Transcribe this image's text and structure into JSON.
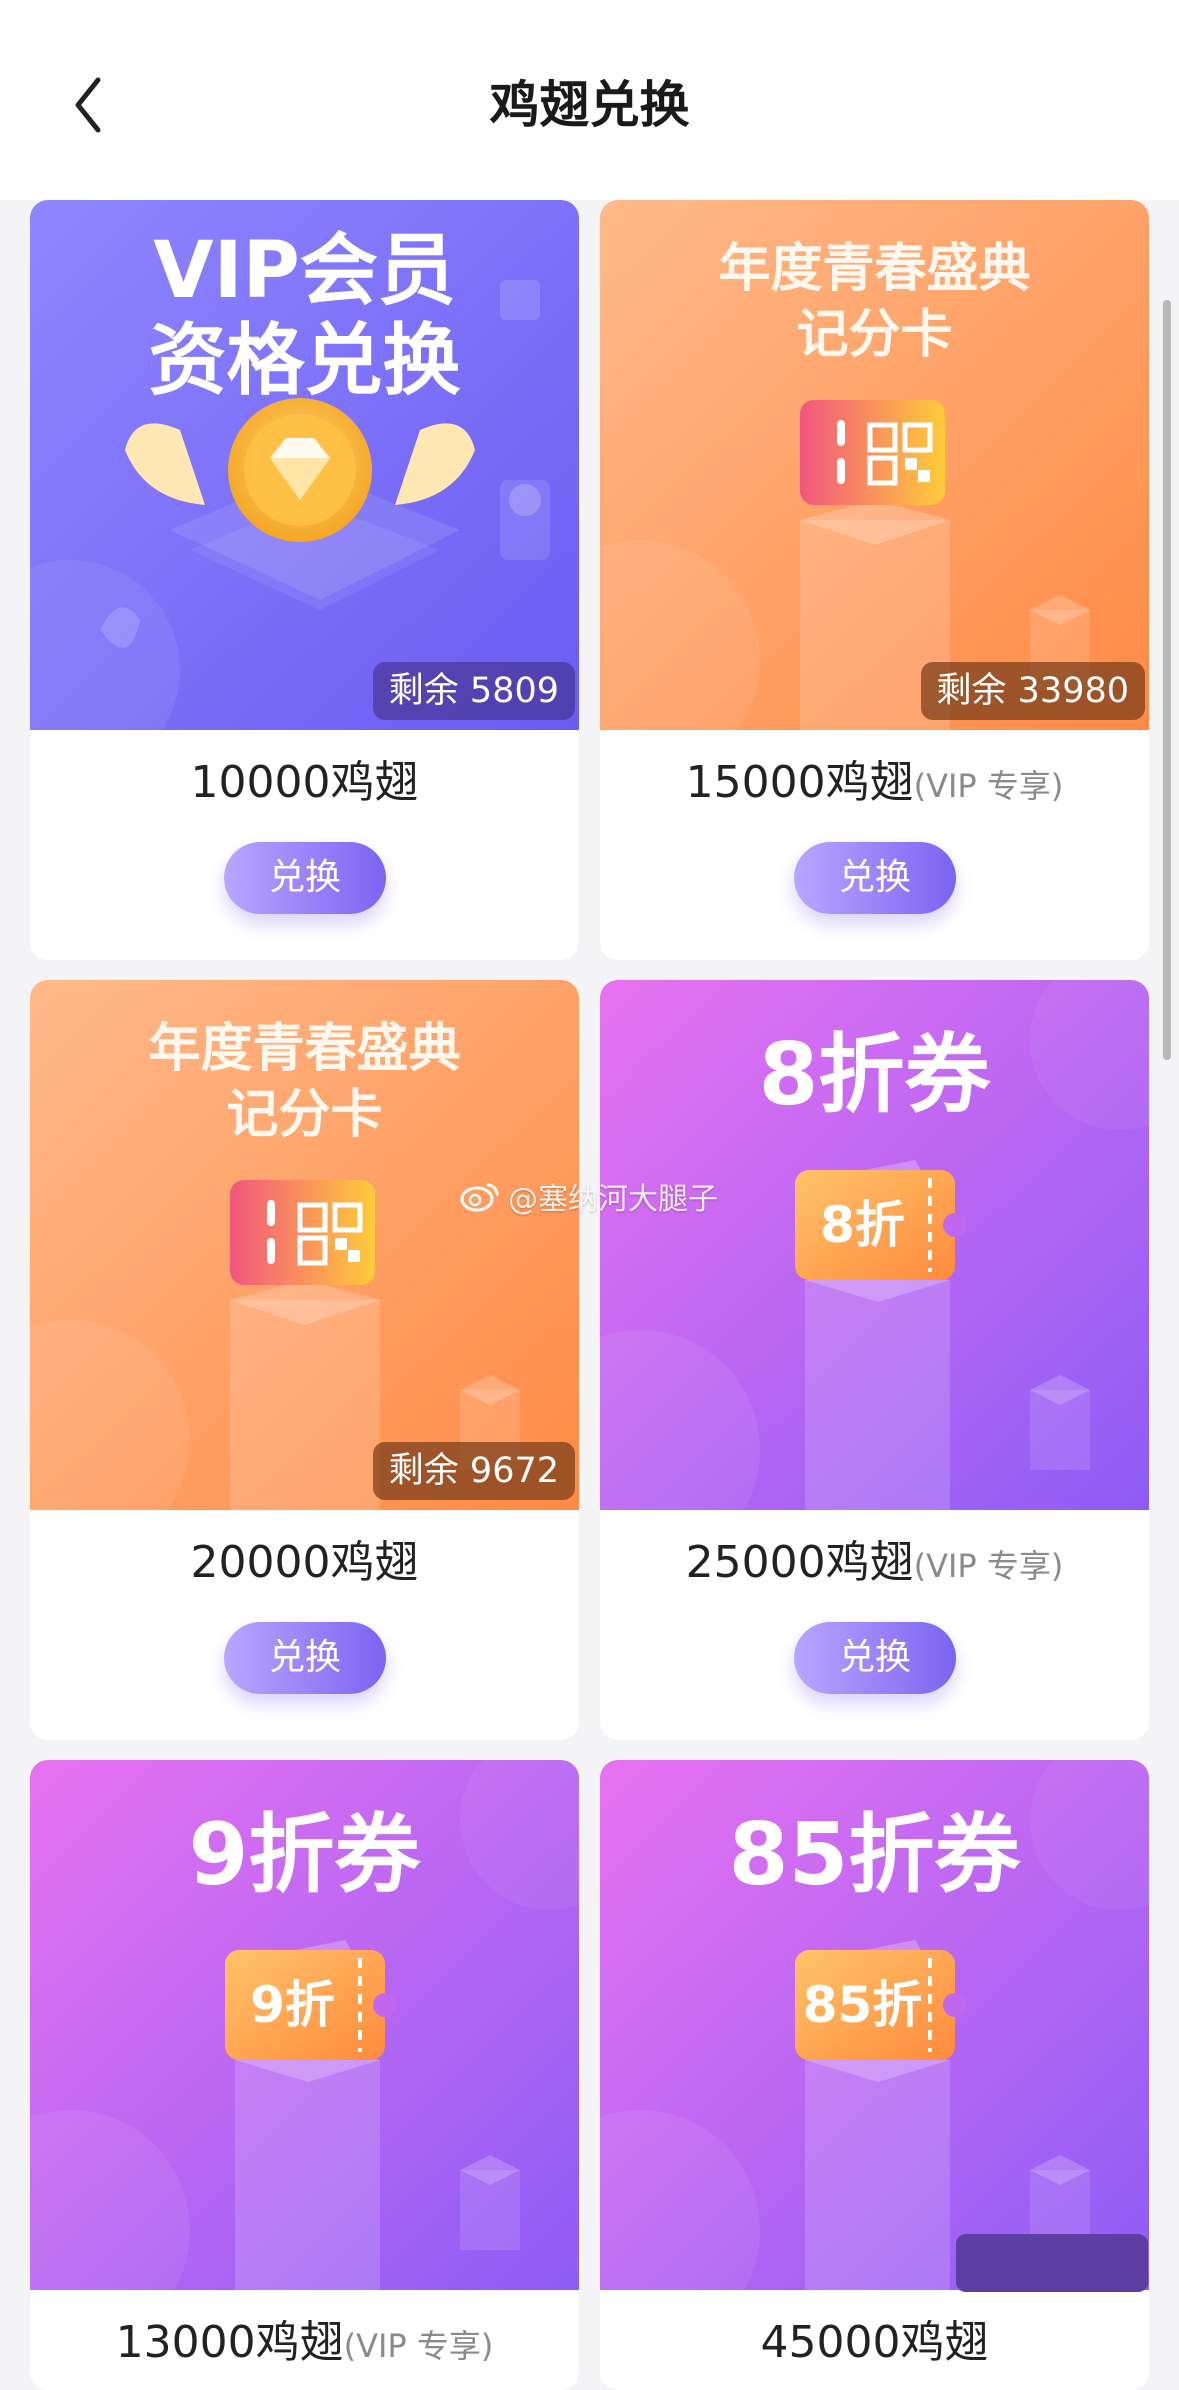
{
  "header": {
    "title": "鸡翅兑换"
  },
  "items": [
    {
      "banner_title": "VIP会员\n资格兑换",
      "remaining": "剩余 5809",
      "price": "10000鸡翅",
      "vip_note": "",
      "button": "兑换",
      "theme": "purple-blue"
    },
    {
      "banner_title": "年度青春盛典\n记分卡",
      "remaining": "剩余 33980",
      "price": "15000鸡翅",
      "vip_note": "(VIP 专享)",
      "button": "兑换",
      "theme": "orange"
    },
    {
      "banner_title": "年度青春盛典\n记分卡",
      "remaining": "剩余 9672",
      "price": "20000鸡翅",
      "vip_note": "",
      "button": "兑换",
      "theme": "orange"
    },
    {
      "banner_title": "8折券",
      "ticket_label": "8折",
      "remaining": "",
      "price": "25000鸡翅",
      "vip_note": "(VIP 专享)",
      "button": "兑换",
      "theme": "magenta"
    },
    {
      "banner_title": "9折券",
      "ticket_label": "9折",
      "remaining": "",
      "price": "13000鸡翅",
      "vip_note": "(VIP 专享)",
      "button": "",
      "theme": "magenta"
    },
    {
      "banner_title": "85折券",
      "ticket_label": "85折",
      "remaining": "",
      "price": "45000鸡翅",
      "vip_note": "",
      "button": "",
      "theme": "magenta"
    }
  ],
  "watermark": "@塞纳河大腿子",
  "colors": {
    "accent_button": "#7c63f2",
    "vip_banner": "#7a6cf7",
    "score_banner": "#ff9a62",
    "coupon_banner": "#c067f0"
  }
}
